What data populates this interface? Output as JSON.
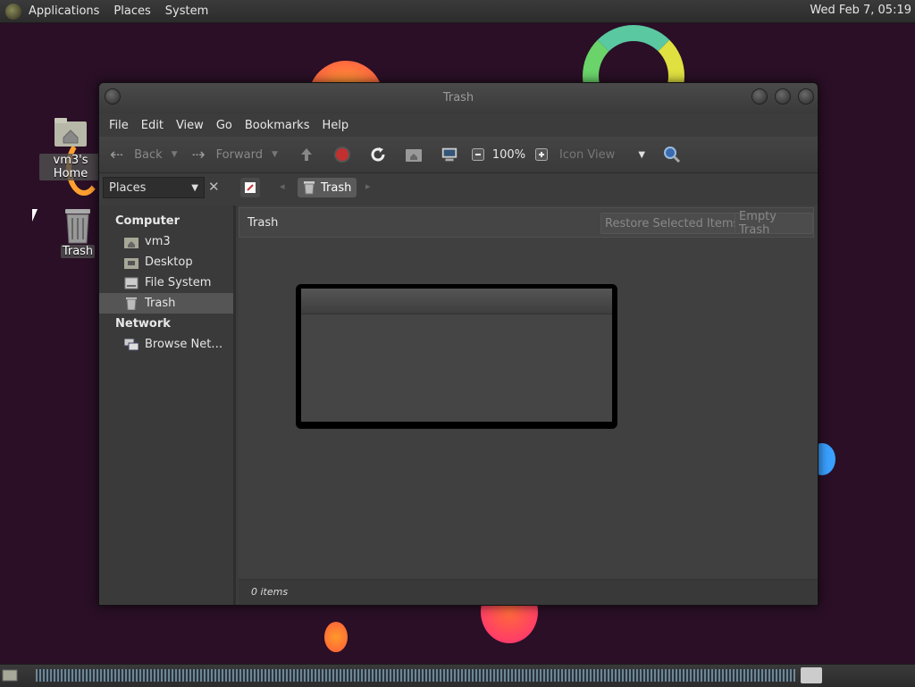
{
  "top_panel": {
    "menus": [
      "Applications",
      "Places",
      "System"
    ],
    "clock": "Wed Feb  7, 05:19"
  },
  "desktop": {
    "icons": [
      {
        "label": "vm3's Home",
        "icon": "home-folder-icon"
      },
      {
        "label": "Trash",
        "icon": "trash-icon"
      }
    ]
  },
  "window": {
    "title": "Trash",
    "menubar": [
      "File",
      "Edit",
      "View",
      "Go",
      "Bookmarks",
      "Help"
    ],
    "toolbar": {
      "back": "Back",
      "forward": "Forward",
      "zoom": "100%",
      "view_mode": "Icon View"
    },
    "sidebar_header": "Places",
    "breadcrumb": "Trash",
    "sidebar": {
      "sections": [
        {
          "title": "Computer",
          "items": [
            {
              "label": "vm3",
              "icon": "home-icon"
            },
            {
              "label": "Desktop",
              "icon": "desktop-folder-icon"
            },
            {
              "label": "File System",
              "icon": "drive-icon"
            },
            {
              "label": "Trash",
              "icon": "trash-icon",
              "selected": true
            }
          ]
        },
        {
          "title": "Network",
          "items": [
            {
              "label": "Browse Net…",
              "icon": "network-icon"
            }
          ]
        }
      ]
    },
    "info_bar": {
      "title": "Trash",
      "restore_label": "Restore Selected Items",
      "empty_label": "Empty Trash"
    },
    "status": "0 items"
  },
  "colors": {
    "desktop_bg": "#2a0f26",
    "blob_orange": "#ff8a2a",
    "blob_green": "#6ad46a",
    "blob_blue": "#3aa0ff",
    "record_red": "#c23030"
  }
}
